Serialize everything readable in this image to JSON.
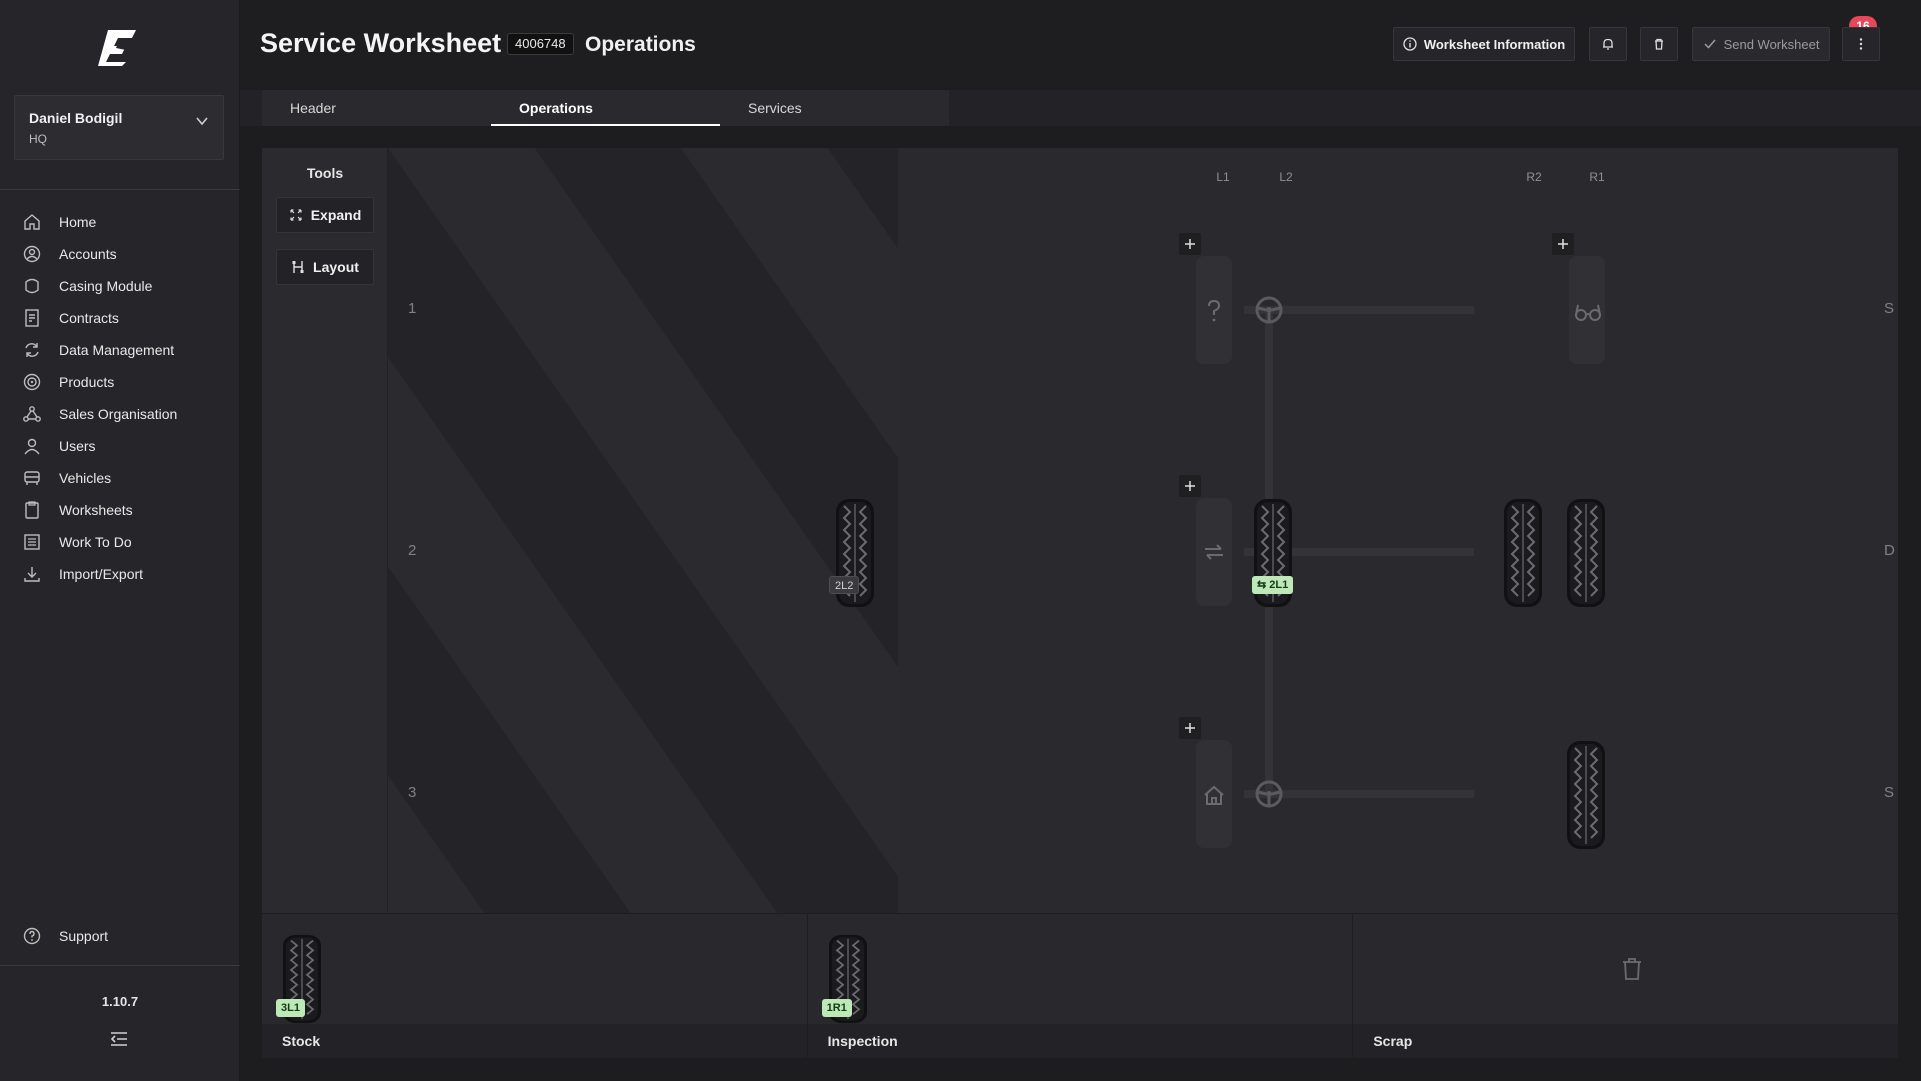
{
  "app": {
    "brand_icon": "bridgestone-b-logo",
    "version": "1.10.7"
  },
  "user": {
    "name": "Daniel Bodigil",
    "org": "HQ"
  },
  "nav": {
    "items": [
      {
        "label": "Home",
        "icon": "home-icon"
      },
      {
        "label": "Accounts",
        "icon": "account-circle-icon"
      },
      {
        "label": "Casing Module",
        "icon": "casing-icon"
      },
      {
        "label": "Contracts",
        "icon": "contract-icon"
      },
      {
        "label": "Data Management",
        "icon": "sync-icon"
      },
      {
        "label": "Products",
        "icon": "tire-product-icon"
      },
      {
        "label": "Sales Organisation",
        "icon": "org-network-icon"
      },
      {
        "label": "Users",
        "icon": "user-icon"
      },
      {
        "label": "Vehicles",
        "icon": "vehicle-icon"
      },
      {
        "label": "Worksheets",
        "icon": "worksheet-icon"
      },
      {
        "label": "Work To Do",
        "icon": "todo-list-icon"
      },
      {
        "label": "Import/Export",
        "icon": "import-export-icon"
      }
    ],
    "support": "Support"
  },
  "header": {
    "title": "Service Worksheet",
    "worksheet_number": "4006748",
    "subtitle": "Operations",
    "info_button": "Worksheet Information",
    "notification_count": "16",
    "send_button": "Send Worksheet"
  },
  "tabs": [
    {
      "label": "Header",
      "active": false
    },
    {
      "label": "Operations",
      "active": true
    },
    {
      "label": "Services",
      "active": false
    }
  ],
  "tools": {
    "title": "Tools",
    "expand": "Expand",
    "layout": "Layout"
  },
  "diagram": {
    "columns": [
      "L1",
      "L2",
      "R2",
      "R1"
    ],
    "rows": [
      {
        "number": "1",
        "type": "S"
      },
      {
        "number": "2",
        "type": "D"
      },
      {
        "number": "3",
        "type": "S"
      }
    ],
    "tags": {
      "loose_tire": "2L2",
      "moved_tire": "2L1"
    }
  },
  "bins": [
    {
      "label": "Stock",
      "tag": "3L1"
    },
    {
      "label": "Inspection",
      "tag": "1R1"
    },
    {
      "label": "Scrap",
      "tag": ""
    }
  ],
  "colors": {
    "accent_badge": "#e8465a",
    "tag_green": "#bfe8b9",
    "background": "#1d1d20"
  }
}
